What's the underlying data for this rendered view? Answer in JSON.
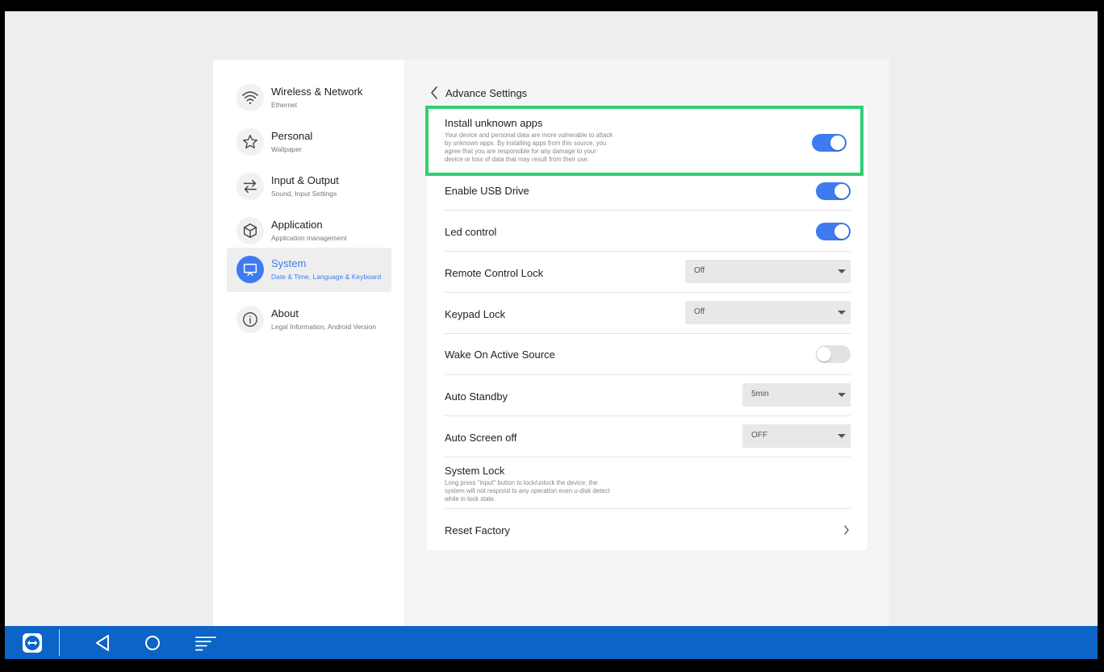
{
  "sidebar": {
    "items": [
      {
        "label": "Wireless & Network",
        "sub": "Ethernet",
        "icon": "wifi-icon"
      },
      {
        "label": "Personal",
        "sub": "Wallpaper",
        "icon": "star-icon"
      },
      {
        "label": "Input & Output",
        "sub": "Sound, Input Settings",
        "icon": "swap-arrows-icon"
      },
      {
        "label": "Application",
        "sub": "Application management",
        "icon": "cube-icon"
      },
      {
        "label": "System",
        "sub": "Date & Time, Language & Keyboard",
        "icon": "monitor-icon",
        "active": true
      },
      {
        "label": "About",
        "sub": "Legal Information, Android Version",
        "icon": "info-icon"
      }
    ]
  },
  "main": {
    "back_title": "Advance Settings",
    "install_unknown": {
      "label": "Install unknown apps",
      "desc": "Your device and personal data are more vulnerable to attack by unknown apps. By installing apps from this source, you agree that you are responsible for any damage to your device or loss of data that may result from their use.",
      "on": true
    },
    "usb_drive": {
      "label": "Enable USB Drive",
      "on": true
    },
    "led_control": {
      "label": "Led control",
      "on": true
    },
    "remote_lock": {
      "label": "Remote Control Lock",
      "value": "Off"
    },
    "keypad_lock": {
      "label": "Keypad Lock",
      "value": "Off"
    },
    "wake_source": {
      "label": "Wake On Active Source",
      "on": false
    },
    "auto_standby": {
      "label": "Auto Standby",
      "value": "5min"
    },
    "auto_screen_off": {
      "label": "Auto Screen off",
      "value": "OFF"
    },
    "system_lock": {
      "label": "System Lock",
      "desc": "Long press \"input\" button to lock/unlock the device, the system will not respond to any operation even u-disk detect while in lock state."
    },
    "reset_factory": {
      "label": "Reset Factory"
    }
  },
  "colors": {
    "accent": "#3f7bf0",
    "highlight": "#2fd072",
    "taskbar": "#0b64c6"
  },
  "taskbar": {
    "buttons": [
      "teamviewer-icon",
      "back-triangle-icon",
      "home-circle-icon",
      "recents-lines-icon"
    ]
  }
}
